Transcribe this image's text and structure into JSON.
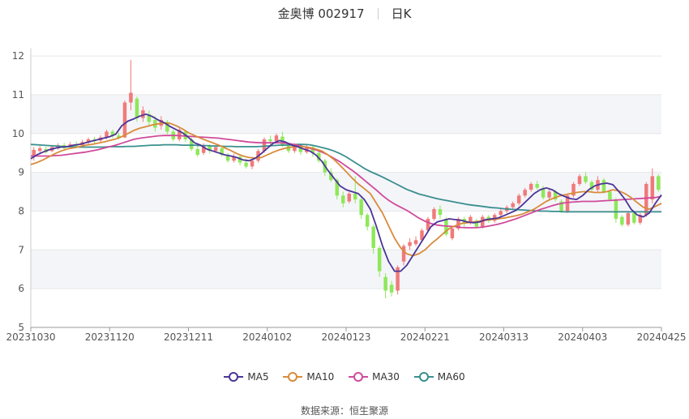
{
  "header": {
    "stock": "金奥博 002917",
    "period": "日K"
  },
  "source": {
    "label": "数据来源：",
    "value": "恒生聚源"
  },
  "legend": [
    {
      "name": "MA5",
      "color": "#4b3597"
    },
    {
      "name": "MA10",
      "color": "#d98b3a"
    },
    {
      "name": "MA30",
      "color": "#d04a9a"
    },
    {
      "name": "MA60",
      "color": "#3a8f8f"
    }
  ],
  "colors": {
    "up": "#f07a7a",
    "down": "#8ee85a",
    "grid": "#e6e6e6",
    "band": "#f4f5f9"
  },
  "chart_data": {
    "type": "candlestick",
    "x_ticks": [
      "20231030",
      "20231120",
      "20231211",
      "20240102",
      "20240123",
      "20240221",
      "20240313",
      "20240403",
      "20240425"
    ],
    "y_ticks": [
      5,
      6,
      7,
      8,
      9,
      10,
      11,
      12
    ],
    "ylim": [
      5,
      12.2
    ],
    "candles": [
      {
        "o": 9.4,
        "c": 9.58,
        "h": 9.65,
        "l": 9.3
      },
      {
        "o": 9.55,
        "c": 9.62,
        "h": 9.68,
        "l": 9.5
      },
      {
        "o": 9.6,
        "c": 9.52,
        "h": 9.66,
        "l": 9.48
      },
      {
        "o": 9.55,
        "c": 9.65,
        "h": 9.7,
        "l": 9.52
      },
      {
        "o": 9.62,
        "c": 9.7,
        "h": 9.75,
        "l": 9.58
      },
      {
        "o": 9.7,
        "c": 9.62,
        "h": 9.76,
        "l": 9.58
      },
      {
        "o": 9.65,
        "c": 9.72,
        "h": 9.78,
        "l": 9.6
      },
      {
        "o": 9.72,
        "c": 9.68,
        "h": 9.8,
        "l": 9.62
      },
      {
        "o": 9.7,
        "c": 9.78,
        "h": 9.84,
        "l": 9.66
      },
      {
        "o": 9.78,
        "c": 9.85,
        "h": 9.9,
        "l": 9.72
      },
      {
        "o": 9.85,
        "c": 9.8,
        "h": 9.92,
        "l": 9.74
      },
      {
        "o": 9.82,
        "c": 9.9,
        "h": 9.96,
        "l": 9.78
      },
      {
        "o": 9.9,
        "c": 10.05,
        "h": 10.1,
        "l": 9.85
      },
      {
        "o": 10.05,
        "c": 9.95,
        "h": 10.1,
        "l": 9.88
      },
      {
        "o": 9.95,
        "c": 9.9,
        "h": 10.02,
        "l": 9.85
      },
      {
        "o": 9.9,
        "c": 10.8,
        "h": 10.85,
        "l": 9.88
      },
      {
        "o": 10.8,
        "c": 11.05,
        "h": 11.9,
        "l": 10.6
      },
      {
        "o": 10.9,
        "c": 10.4,
        "h": 10.95,
        "l": 10.3
      },
      {
        "o": 10.4,
        "c": 10.6,
        "h": 10.7,
        "l": 10.3
      },
      {
        "o": 10.5,
        "c": 10.3,
        "h": 10.6,
        "l": 10.2
      },
      {
        "o": 10.35,
        "c": 10.15,
        "h": 10.45,
        "l": 10.05
      },
      {
        "o": 10.2,
        "c": 10.35,
        "h": 10.45,
        "l": 10.1
      },
      {
        "o": 10.3,
        "c": 10.05,
        "h": 10.35,
        "l": 9.98
      },
      {
        "o": 10.05,
        "c": 9.85,
        "h": 10.1,
        "l": 9.8
      },
      {
        "o": 9.85,
        "c": 10.1,
        "h": 10.15,
        "l": 9.8
      },
      {
        "o": 10.05,
        "c": 9.85,
        "h": 10.1,
        "l": 9.78
      },
      {
        "o": 9.85,
        "c": 9.6,
        "h": 9.9,
        "l": 9.55
      },
      {
        "o": 9.6,
        "c": 9.45,
        "h": 9.7,
        "l": 9.4
      },
      {
        "o": 9.5,
        "c": 9.7,
        "h": 9.75,
        "l": 9.45
      },
      {
        "o": 9.68,
        "c": 9.55,
        "h": 9.72,
        "l": 9.48
      },
      {
        "o": 9.55,
        "c": 9.65,
        "h": 9.7,
        "l": 9.5
      },
      {
        "o": 9.62,
        "c": 9.45,
        "h": 9.66,
        "l": 9.4
      },
      {
        "o": 9.45,
        "c": 9.3,
        "h": 9.5,
        "l": 9.25
      },
      {
        "o": 9.3,
        "c": 9.4,
        "h": 9.48,
        "l": 9.25
      },
      {
        "o": 9.4,
        "c": 9.25,
        "h": 9.45,
        "l": 9.18
      },
      {
        "o": 9.25,
        "c": 9.15,
        "h": 9.35,
        "l": 9.1
      },
      {
        "o": 9.15,
        "c": 9.3,
        "h": 9.35,
        "l": 9.08
      },
      {
        "o": 9.3,
        "c": 9.55,
        "h": 9.6,
        "l": 9.25
      },
      {
        "o": 9.55,
        "c": 9.85,
        "h": 9.9,
        "l": 9.5
      },
      {
        "o": 9.85,
        "c": 9.8,
        "h": 9.95,
        "l": 9.7
      },
      {
        "o": 9.8,
        "c": 9.95,
        "h": 10.0,
        "l": 9.75
      },
      {
        "o": 9.92,
        "c": 9.7,
        "h": 10.05,
        "l": 9.65
      },
      {
        "o": 9.7,
        "c": 9.55,
        "h": 9.75,
        "l": 9.5
      },
      {
        "o": 9.55,
        "c": 9.7,
        "h": 9.75,
        "l": 9.5
      },
      {
        "o": 9.7,
        "c": 9.52,
        "h": 9.74,
        "l": 9.45
      },
      {
        "o": 9.52,
        "c": 9.65,
        "h": 9.7,
        "l": 9.48
      },
      {
        "o": 9.65,
        "c": 9.5,
        "h": 9.68,
        "l": 9.4
      },
      {
        "o": 9.5,
        "c": 9.3,
        "h": 9.55,
        "l": 9.25
      },
      {
        "o": 9.3,
        "c": 9.0,
        "h": 9.35,
        "l": 8.9
      },
      {
        "o": 9.0,
        "c": 8.8,
        "h": 9.1,
        "l": 8.75
      },
      {
        "o": 8.8,
        "c": 8.4,
        "h": 8.85,
        "l": 8.3
      },
      {
        "o": 8.4,
        "c": 8.2,
        "h": 8.5,
        "l": 8.1
      },
      {
        "o": 8.25,
        "c": 8.45,
        "h": 8.5,
        "l": 8.2
      },
      {
        "o": 8.45,
        "c": 8.3,
        "h": 8.9,
        "l": 8.2
      },
      {
        "o": 8.3,
        "c": 7.9,
        "h": 8.35,
        "l": 7.8
      },
      {
        "o": 7.9,
        "c": 7.6,
        "h": 7.95,
        "l": 7.5
      },
      {
        "o": 7.6,
        "c": 7.05,
        "h": 7.65,
        "l": 6.9
      },
      {
        "o": 7.05,
        "c": 6.45,
        "h": 7.1,
        "l": 6.3
      },
      {
        "o": 6.3,
        "c": 5.95,
        "h": 6.4,
        "l": 5.75
      },
      {
        "o": 6.1,
        "c": 5.9,
        "h": 6.2,
        "l": 5.8
      },
      {
        "o": 5.95,
        "c": 6.55,
        "h": 6.6,
        "l": 5.85
      },
      {
        "o": 6.7,
        "c": 7.1,
        "h": 7.15,
        "l": 6.6
      },
      {
        "o": 7.1,
        "c": 7.2,
        "h": 7.3,
        "l": 7.0
      },
      {
        "o": 7.15,
        "c": 7.25,
        "h": 7.35,
        "l": 7.1
      },
      {
        "o": 7.25,
        "c": 7.5,
        "h": 7.55,
        "l": 7.2
      },
      {
        "o": 7.5,
        "c": 7.8,
        "h": 7.85,
        "l": 7.45
      },
      {
        "o": 7.8,
        "c": 8.05,
        "h": 8.1,
        "l": 7.75
      },
      {
        "o": 8.05,
        "c": 7.9,
        "h": 8.15,
        "l": 7.8
      },
      {
        "o": 7.8,
        "c": 7.4,
        "h": 7.85,
        "l": 7.35
      },
      {
        "o": 7.3,
        "c": 7.55,
        "h": 7.6,
        "l": 7.25
      },
      {
        "o": 7.55,
        "c": 7.8,
        "h": 7.85,
        "l": 7.5
      },
      {
        "o": 7.8,
        "c": 7.7,
        "h": 7.85,
        "l": 7.6
      },
      {
        "o": 7.7,
        "c": 7.85,
        "h": 7.9,
        "l": 7.65
      },
      {
        "o": 7.75,
        "c": 7.6,
        "h": 7.8,
        "l": 7.55
      },
      {
        "o": 7.6,
        "c": 7.85,
        "h": 7.9,
        "l": 7.55
      },
      {
        "o": 7.85,
        "c": 7.75,
        "h": 7.9,
        "l": 7.7
      },
      {
        "o": 7.75,
        "c": 7.9,
        "h": 7.95,
        "l": 7.7
      },
      {
        "o": 7.9,
        "c": 8.0,
        "h": 8.05,
        "l": 7.85
      },
      {
        "o": 8.0,
        "c": 8.1,
        "h": 8.15,
        "l": 7.95
      },
      {
        "o": 8.1,
        "c": 8.2,
        "h": 8.25,
        "l": 8.05
      },
      {
        "o": 8.2,
        "c": 8.4,
        "h": 8.45,
        "l": 8.15
      },
      {
        "o": 8.4,
        "c": 8.55,
        "h": 8.6,
        "l": 8.35
      },
      {
        "o": 8.55,
        "c": 8.7,
        "h": 8.75,
        "l": 8.5
      },
      {
        "o": 8.7,
        "c": 8.6,
        "h": 8.78,
        "l": 8.55
      },
      {
        "o": 8.6,
        "c": 8.35,
        "h": 8.65,
        "l": 8.3
      },
      {
        "o": 8.35,
        "c": 8.5,
        "h": 8.55,
        "l": 8.3
      },
      {
        "o": 8.5,
        "c": 8.3,
        "h": 8.55,
        "l": 8.25
      },
      {
        "o": 8.25,
        "c": 8.0,
        "h": 8.3,
        "l": 7.95
      },
      {
        "o": 8.0,
        "c": 8.4,
        "h": 8.45,
        "l": 7.95
      },
      {
        "o": 8.4,
        "c": 8.7,
        "h": 8.75,
        "l": 8.35
      },
      {
        "o": 8.7,
        "c": 8.9,
        "h": 8.95,
        "l": 8.65
      },
      {
        "o": 8.9,
        "c": 8.75,
        "h": 9.0,
        "l": 8.7
      },
      {
        "o": 8.75,
        "c": 8.55,
        "h": 8.8,
        "l": 8.5
      },
      {
        "o": 8.55,
        "c": 8.8,
        "h": 8.9,
        "l": 8.5
      },
      {
        "o": 8.8,
        "c": 8.5,
        "h": 8.85,
        "l": 8.45
      },
      {
        "o": 8.5,
        "c": 8.3,
        "h": 8.55,
        "l": 8.25
      },
      {
        "o": 8.3,
        "c": 7.8,
        "h": 8.35,
        "l": 7.7
      },
      {
        "o": 7.85,
        "c": 7.65,
        "h": 7.9,
        "l": 7.6
      },
      {
        "o": 7.65,
        "c": 7.95,
        "h": 8.0,
        "l": 7.6
      },
      {
        "o": 7.95,
        "c": 7.7,
        "h": 8.0,
        "l": 7.65
      },
      {
        "o": 7.7,
        "c": 7.9,
        "h": 7.95,
        "l": 7.65
      },
      {
        "o": 7.9,
        "c": 8.7,
        "h": 8.75,
        "l": 7.85
      },
      {
        "o": 8.3,
        "c": 8.9,
        "h": 9.1,
        "l": 8.2
      },
      {
        "o": 8.9,
        "c": 8.55,
        "h": 8.95,
        "l": 8.5
      }
    ],
    "series": [
      {
        "name": "MA5",
        "values": [
          9.35,
          9.45,
          9.52,
          9.58,
          9.62,
          9.65,
          9.66,
          9.7,
          9.72,
          9.76,
          9.8,
          9.84,
          9.88,
          9.92,
          9.98,
          10.2,
          10.32,
          10.38,
          10.45,
          10.5,
          10.44,
          10.35,
          10.28,
          10.18,
          10.1,
          10.02,
          9.9,
          9.76,
          9.7,
          9.6,
          9.55,
          9.5,
          9.45,
          9.42,
          9.38,
          9.32,
          9.3,
          9.36,
          9.48,
          9.62,
          9.75,
          9.82,
          9.78,
          9.7,
          9.66,
          9.6,
          9.55,
          9.45,
          9.28,
          9.05,
          8.85,
          8.65,
          8.55,
          8.5,
          8.45,
          8.3,
          8.05,
          7.6,
          7.1,
          6.7,
          6.45,
          6.45,
          6.6,
          6.85,
          7.1,
          7.35,
          7.6,
          7.72,
          7.76,
          7.8,
          7.78,
          7.76,
          7.72,
          7.7,
          7.72,
          7.78,
          7.8,
          7.82,
          7.88,
          7.95,
          8.02,
          8.15,
          8.3,
          8.45,
          8.55,
          8.6,
          8.55,
          8.45,
          8.38,
          8.32,
          8.3,
          8.4,
          8.55,
          8.65,
          8.7,
          8.72,
          8.68,
          8.5,
          8.3,
          8.05,
          7.9,
          7.85,
          7.95,
          8.2,
          8.42
        ]
      },
      {
        "name": "MA10",
        "values": [
          9.2,
          9.25,
          9.32,
          9.4,
          9.48,
          9.55,
          9.6,
          9.63,
          9.66,
          9.7,
          9.72,
          9.75,
          9.78,
          9.82,
          9.86,
          9.92,
          10.0,
          10.08,
          10.14,
          10.18,
          10.22,
          10.25,
          10.27,
          10.26,
          10.2,
          10.12,
          10.02,
          9.95,
          9.88,
          9.82,
          9.76,
          9.7,
          9.63,
          9.56,
          9.48,
          9.42,
          9.38,
          9.37,
          9.38,
          9.45,
          9.52,
          9.58,
          9.62,
          9.65,
          9.66,
          9.66,
          9.64,
          9.6,
          9.55,
          9.45,
          9.33,
          9.18,
          9.02,
          8.85,
          8.7,
          8.58,
          8.45,
          8.2,
          7.95,
          7.62,
          7.3,
          7.05,
          6.9,
          6.85,
          6.9,
          7.0,
          7.15,
          7.28,
          7.42,
          7.55,
          7.62,
          7.68,
          7.7,
          7.72,
          7.74,
          7.76,
          7.78,
          7.8,
          7.82,
          7.85,
          7.88,
          7.92,
          7.98,
          8.05,
          8.15,
          8.25,
          8.32,
          8.38,
          8.42,
          8.45,
          8.48,
          8.5,
          8.5,
          8.48,
          8.48,
          8.5,
          8.55,
          8.52,
          8.45,
          8.35,
          8.22,
          8.1,
          8.05,
          8.12,
          8.2
        ]
      },
      {
        "name": "MA30",
        "values": [
          9.42,
          9.42,
          9.42,
          9.42,
          9.43,
          9.44,
          9.46,
          9.48,
          9.5,
          9.52,
          9.55,
          9.58,
          9.62,
          9.66,
          9.7,
          9.75,
          9.8,
          9.85,
          9.88,
          9.9,
          9.92,
          9.94,
          9.95,
          9.95,
          9.95,
          9.94,
          9.93,
          9.92,
          9.91,
          9.9,
          9.89,
          9.88,
          9.86,
          9.84,
          9.82,
          9.8,
          9.78,
          9.77,
          9.76,
          9.76,
          9.76,
          9.76,
          9.75,
          9.73,
          9.7,
          9.66,
          9.62,
          9.58,
          9.52,
          9.45,
          9.36,
          9.27,
          9.16,
          9.05,
          8.93,
          8.8,
          8.67,
          8.54,
          8.4,
          8.28,
          8.18,
          8.1,
          8.02,
          7.92,
          7.82,
          7.74,
          7.68,
          7.64,
          7.62,
          7.61,
          7.6,
          7.58,
          7.57,
          7.57,
          7.58,
          7.6,
          7.63,
          7.66,
          7.7,
          7.75,
          7.8,
          7.86,
          7.92,
          7.98,
          8.04,
          8.09,
          8.14,
          8.18,
          8.21,
          8.23,
          8.24,
          8.25,
          8.25,
          8.25,
          8.26,
          8.27,
          8.28,
          8.29,
          8.3,
          8.31,
          8.32,
          8.33,
          8.34,
          8.35,
          8.38
        ]
      },
      {
        "name": "MA60",
        "values": [
          9.72,
          9.71,
          9.7,
          9.69,
          9.68,
          9.67,
          9.66,
          9.66,
          9.65,
          9.65,
          9.65,
          9.65,
          9.65,
          9.66,
          9.66,
          9.66,
          9.67,
          9.67,
          9.68,
          9.69,
          9.7,
          9.7,
          9.71,
          9.71,
          9.71,
          9.7,
          9.7,
          9.7,
          9.69,
          9.69,
          9.68,
          9.68,
          9.67,
          9.67,
          9.66,
          9.66,
          9.66,
          9.66,
          9.67,
          9.68,
          9.69,
          9.7,
          9.7,
          9.71,
          9.72,
          9.72,
          9.71,
          9.68,
          9.64,
          9.6,
          9.55,
          9.48,
          9.4,
          9.3,
          9.2,
          9.1,
          9.02,
          8.95,
          8.88,
          8.8,
          8.72,
          8.64,
          8.56,
          8.5,
          8.44,
          8.4,
          8.36,
          8.32,
          8.29,
          8.26,
          8.23,
          8.2,
          8.17,
          8.15,
          8.13,
          8.11,
          8.09,
          8.08,
          8.06,
          8.05,
          8.04,
          8.03,
          8.02,
          8.01,
          8.0,
          8.0,
          7.99,
          7.99,
          7.98,
          7.98,
          7.98,
          7.98,
          7.98,
          7.98,
          7.98,
          7.98,
          7.98,
          7.98,
          7.98,
          7.98,
          7.98,
          7.98,
          7.98,
          7.98,
          7.98
        ]
      }
    ]
  }
}
